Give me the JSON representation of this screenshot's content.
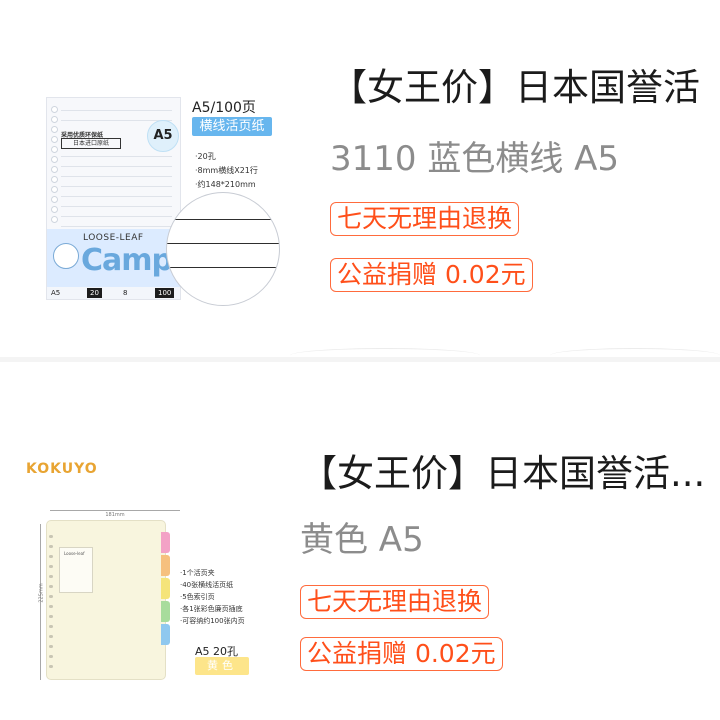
{
  "products": [
    {
      "title": "【女王价】日本国誉活",
      "variant": "3110 蓝色横线 A5",
      "tags": [
        "七天无理由退换",
        "公益捐赠 0.02元"
      ],
      "image": {
        "spec_title": "A5/100页",
        "spec_pill": "横线活页纸",
        "spec_lines": [
          "·20孔",
          "·8mm横线X21行",
          "·约148*210mm"
        ],
        "circle_text": "A5",
        "import_label": "采用优质环保纸",
        "import_box": "日本进口原纸",
        "loose_leaf": "LOOSE-LEAF",
        "brand": "Campu",
        "bottom_a5": "A5",
        "bottom_20": "20",
        "bottom_8": "8",
        "bottom_100": "100"
      }
    },
    {
      "title": "【女王价】日本国誉活...",
      "variant": "黄色 A5",
      "tags": [
        "七天无理由退换",
        "公益捐赠 0.02元"
      ],
      "image": {
        "brand": "KOKUYO",
        "dim_width": "181mm",
        "dim_height": "225mm",
        "cover_text": "Loose-leaf",
        "bullets": [
          "·1个活页夹",
          "·40张横线活页纸",
          "·5色索引页",
          "·各1张彩色廉页插底",
          "·可容纳约100张内页"
        ],
        "size_label": "A5 20孔",
        "color_label": "黄色"
      }
    }
  ]
}
